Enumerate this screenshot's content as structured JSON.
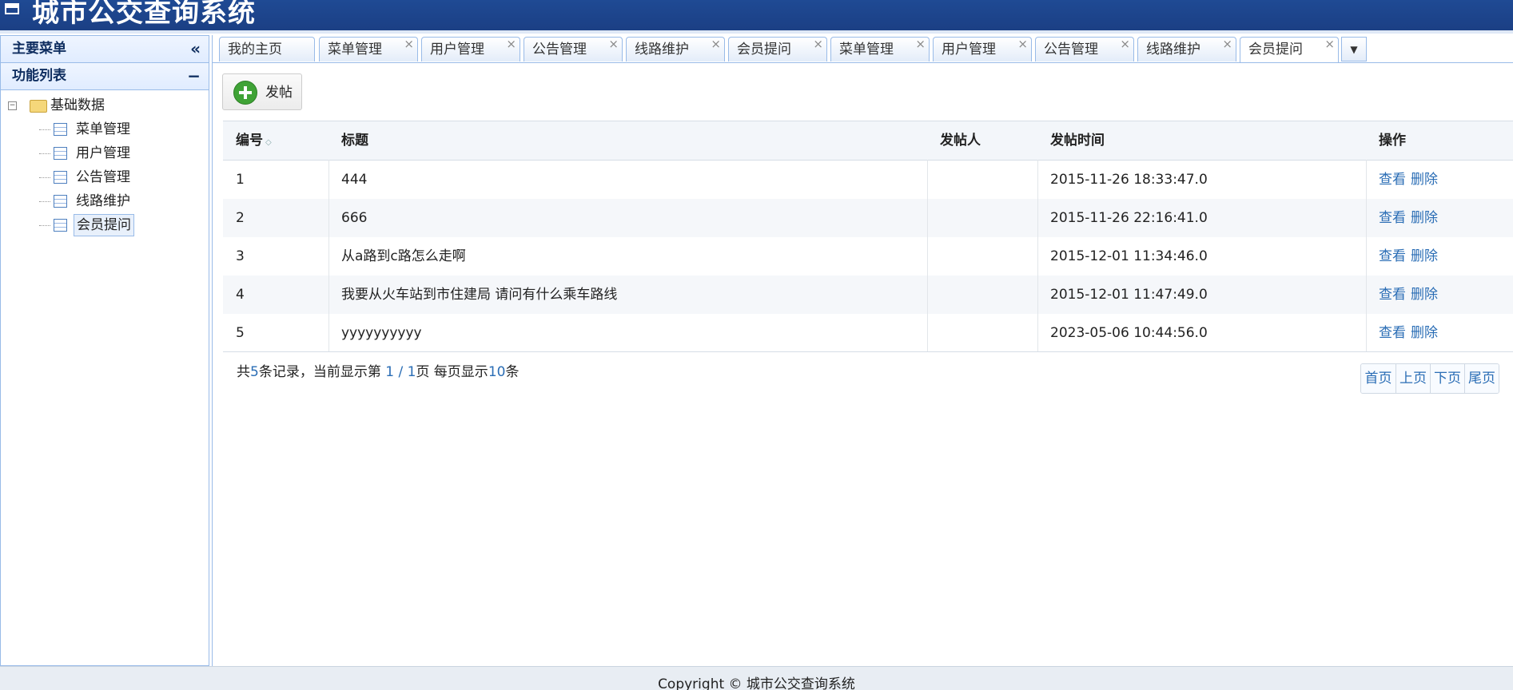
{
  "app": {
    "title": "城市公交查询系统"
  },
  "sidebar": {
    "main_menu_title": "主要菜单",
    "collapse_symbol": "«",
    "func_list_title": "功能列表",
    "func_collapse_symbol": "−",
    "tree": {
      "root_label": "基础数据",
      "toggle_symbol": "−",
      "items": [
        {
          "label": "菜单管理"
        },
        {
          "label": "用户管理"
        },
        {
          "label": "公告管理"
        },
        {
          "label": "线路维护"
        },
        {
          "label": "会员提问"
        }
      ],
      "selected_index": 4
    }
  },
  "tabs": {
    "items": [
      {
        "label": "我的主页",
        "closable": false
      },
      {
        "label": "菜单管理",
        "closable": true
      },
      {
        "label": "用户管理",
        "closable": true
      },
      {
        "label": "公告管理",
        "closable": true
      },
      {
        "label": "线路维护",
        "closable": true
      },
      {
        "label": "会员提问",
        "closable": true
      },
      {
        "label": "菜单管理",
        "closable": true
      },
      {
        "label": "用户管理",
        "closable": true
      },
      {
        "label": "公告管理",
        "closable": true
      },
      {
        "label": "线路维护",
        "closable": true
      },
      {
        "label": "会员提问",
        "closable": true
      }
    ],
    "active_index": 10,
    "close_symbol": "×",
    "more_symbol": "▼"
  },
  "toolbar": {
    "post_label": "发帖"
  },
  "table": {
    "columns": [
      "编号",
      "标题",
      "发帖人",
      "发帖时间",
      "操作"
    ],
    "sort_symbol": "◇",
    "rows": [
      {
        "id": "1",
        "title": "444",
        "poster": "",
        "time": "2015-11-26 18:33:47.0"
      },
      {
        "id": "2",
        "title": "666",
        "poster": "",
        "time": "2015-11-26 22:16:41.0"
      },
      {
        "id": "3",
        "title": "从a路到c路怎么走啊",
        "poster": "",
        "time": "2015-12-01 11:34:46.0"
      },
      {
        "id": "4",
        "title": "我要从火车站到市住建局 请问有什么乘车路线",
        "poster": "",
        "time": "2015-12-01 11:47:49.0"
      },
      {
        "id": "5",
        "title": "yyyyyyyyyy",
        "poster": "",
        "time": "2023-05-06 10:44:56.0"
      }
    ],
    "action_view": "查看",
    "action_delete": "删除"
  },
  "pagination": {
    "text_prefix": "共",
    "total": "5",
    "text_mid1": "条记录，当前显示第 ",
    "current_page": "1 / 1",
    "text_mid2": "页 每页显示",
    "page_size": "10",
    "text_suffix": "条",
    "buttons": [
      "首页",
      "上页",
      "下页",
      "尾页"
    ]
  },
  "footer": {
    "copyright": "Copyright © 城市公交查询系统"
  }
}
